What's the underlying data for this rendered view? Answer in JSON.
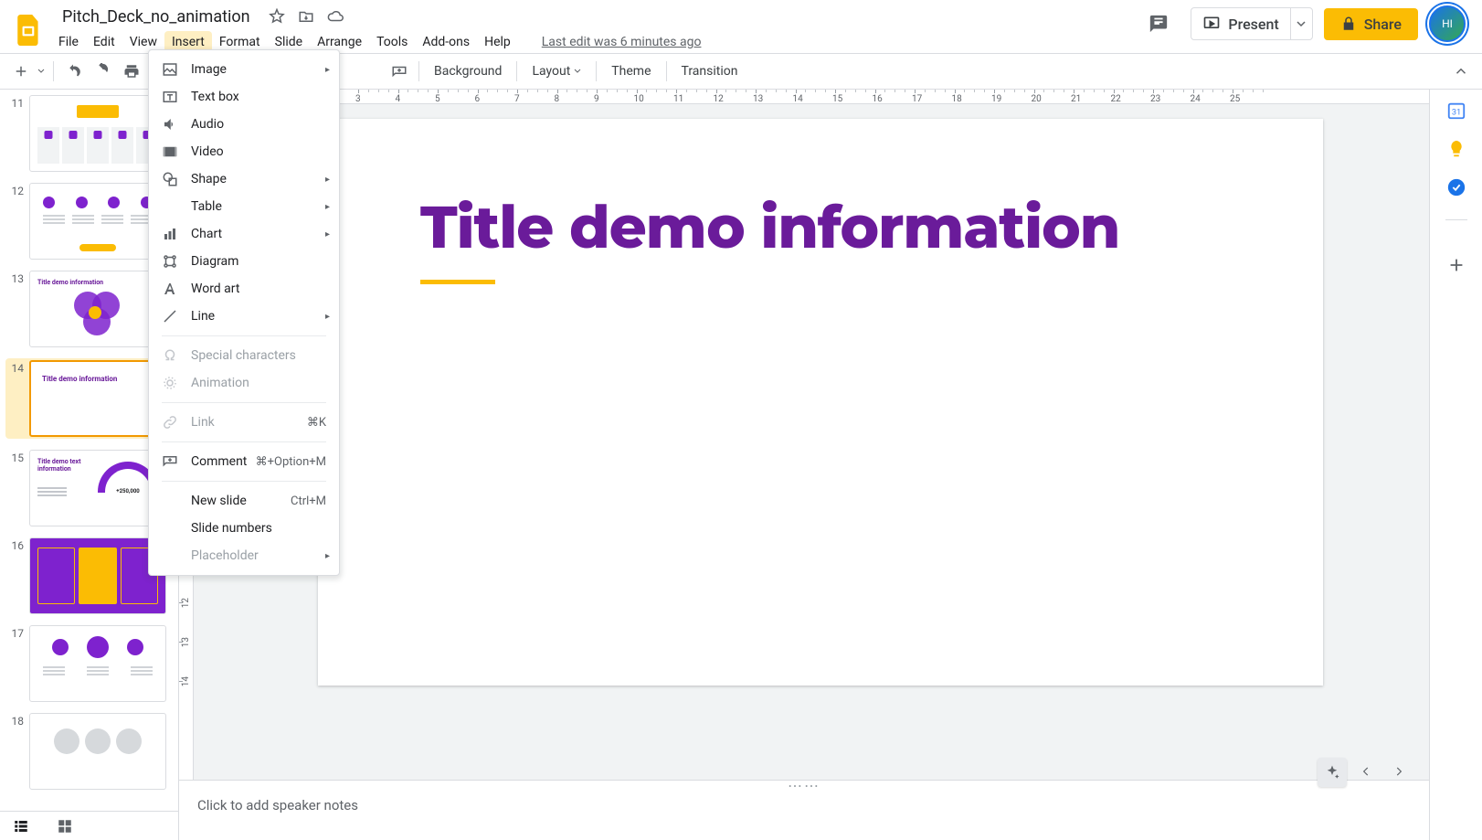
{
  "app_name": "Google Slides",
  "doc_title": "Pitch_Deck_no_animation",
  "avatar_initials": "HI",
  "last_edit": "Last edit was 6 minutes ago",
  "menus": {
    "file": "File",
    "edit": "Edit",
    "view": "View",
    "insert": "Insert",
    "format": "Format",
    "slide": "Slide",
    "arrange": "Arrange",
    "tools": "Tools",
    "addons": "Add-ons",
    "help": "Help"
  },
  "header": {
    "present": "Present",
    "share": "Share"
  },
  "toolbar": {
    "background": "Background",
    "layout": "Layout",
    "theme": "Theme",
    "transition": "Transition"
  },
  "insert_menu": {
    "image": "Image",
    "textbox": "Text box",
    "audio": "Audio",
    "video": "Video",
    "shape": "Shape",
    "table": "Table",
    "chart": "Chart",
    "diagram": "Diagram",
    "wordart": "Word art",
    "line": "Line",
    "special": "Special characters",
    "animation": "Animation",
    "link": "Link",
    "link_sc": "⌘K",
    "comment": "Comment",
    "comment_sc": "⌘+Option+M",
    "newslide": "New slide",
    "newslide_sc": "Ctrl+M",
    "slidenum": "Slide numbers",
    "placeholder": "Placeholder"
  },
  "ruler_h": [
    3,
    4,
    5,
    6,
    7,
    8,
    9,
    10,
    11,
    12,
    13,
    14,
    15,
    16,
    17,
    18,
    19,
    20,
    21,
    22,
    23,
    24,
    25
  ],
  "ruler_v": [
    12,
    13,
    14
  ],
  "slide_title": "Title demo information",
  "speaker_notes_placeholder": "Click to add speaker notes",
  "filmstrip": [
    {
      "num": 11,
      "kind": "cols5"
    },
    {
      "num": 12,
      "kind": "dots4"
    },
    {
      "num": 13,
      "kind": "venn",
      "title": "Title demo information"
    },
    {
      "num": 14,
      "kind": "title",
      "title": "Title demo information",
      "selected": true
    },
    {
      "num": 15,
      "kind": "gauge",
      "title": "Title demo text information",
      "value": "+250,000"
    },
    {
      "num": 16,
      "kind": "cards3"
    },
    {
      "num": 17,
      "kind": "circ3"
    },
    {
      "num": 18,
      "kind": "gray3"
    }
  ],
  "colors": {
    "accent": "#6a1b9a",
    "brand_yellow": "#fbbc04"
  }
}
